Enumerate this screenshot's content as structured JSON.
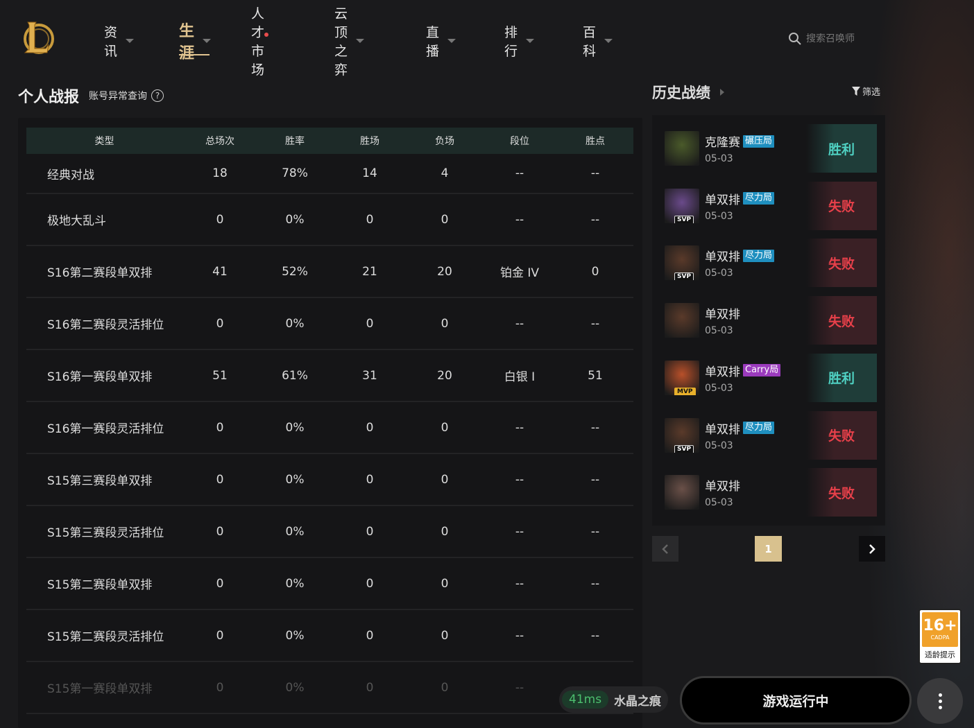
{
  "nav": {
    "items": [
      {
        "label": "资讯",
        "dropdown": true
      },
      {
        "label": "生涯",
        "dropdown": true,
        "active": true
      },
      {
        "label": "人才市场",
        "dropdown": false,
        "dot": true
      },
      {
        "label": "云顶之弈",
        "dropdown": true
      },
      {
        "label": "直播",
        "dropdown": true
      },
      {
        "label": "排行",
        "dropdown": true
      },
      {
        "label": "百科",
        "dropdown": true
      }
    ],
    "search_placeholder": "搜索召唤师"
  },
  "stats": {
    "title": "个人战报",
    "subtitle": "账号异常查询",
    "help_symbol": "?",
    "headers": [
      "类型",
      "总场次",
      "胜率",
      "胜场",
      "负场",
      "段位",
      "胜点"
    ],
    "rows": [
      [
        "经典对战",
        "18",
        "78%",
        "14",
        "4",
        "--",
        "--"
      ],
      [
        "极地大乱斗",
        "0",
        "0%",
        "0",
        "0",
        "--",
        "--"
      ],
      [
        "S16第二赛段单双排",
        "41",
        "52%",
        "21",
        "20",
        "铂金 IV",
        "0"
      ],
      [
        "S16第二赛段灵活排位",
        "0",
        "0%",
        "0",
        "0",
        "--",
        "--"
      ],
      [
        "S16第一赛段单双排",
        "51",
        "61%",
        "31",
        "20",
        "白银 I",
        "51"
      ],
      [
        "S16第一赛段灵活排位",
        "0",
        "0%",
        "0",
        "0",
        "--",
        "--"
      ],
      [
        "S15第三赛段单双排",
        "0",
        "0%",
        "0",
        "0",
        "--",
        "--"
      ],
      [
        "S15第三赛段灵活排位",
        "0",
        "0%",
        "0",
        "0",
        "--",
        "--"
      ],
      [
        "S15第二赛段单双排",
        "0",
        "0%",
        "0",
        "0",
        "--",
        "--"
      ],
      [
        "S15第二赛段灵活排位",
        "0",
        "0%",
        "0",
        "0",
        "--",
        "--"
      ],
      [
        "S15第一赛段单双排",
        "0",
        "0%",
        "0",
        "0",
        "--",
        "--"
      ]
    ]
  },
  "history": {
    "title": "历史战绩",
    "filter_label": "筛选",
    "matches": [
      {
        "mode": "克隆赛",
        "tag": "碾压局",
        "tag_color": "blue",
        "date": "05-03",
        "result": "胜利",
        "outcome": "win",
        "badge": "",
        "avatar_color": "#4a5a2a"
      },
      {
        "mode": "单双排",
        "tag": "尽力局",
        "tag_color": "blue",
        "date": "05-03",
        "result": "失败",
        "outcome": "lose",
        "badge": "SVP",
        "avatar_color": "#6a4a8a"
      },
      {
        "mode": "单双排",
        "tag": "尽力局",
        "tag_color": "blue",
        "date": "05-03",
        "result": "失败",
        "outcome": "lose",
        "badge": "SVP",
        "avatar_color": "#5a3a2a"
      },
      {
        "mode": "单双排",
        "tag": "",
        "tag_color": "",
        "date": "05-03",
        "result": "失败",
        "outcome": "lose",
        "badge": "",
        "avatar_color": "#5a3a2a"
      },
      {
        "mode": "单双排",
        "tag": "Carry局",
        "tag_color": "purple",
        "date": "05-03",
        "result": "胜利",
        "outcome": "win",
        "badge": "MVP",
        "avatar_color": "#b8502a"
      },
      {
        "mode": "单双排",
        "tag": "尽力局",
        "tag_color": "blue",
        "date": "05-03",
        "result": "失败",
        "outcome": "lose",
        "badge": "SVP",
        "avatar_color": "#5a3a2a"
      },
      {
        "mode": "单双排",
        "tag": "",
        "tag_color": "",
        "date": "05-03",
        "result": "失败",
        "outcome": "lose",
        "badge": "",
        "avatar_color": "#6a5048"
      }
    ],
    "page": "1"
  },
  "footer": {
    "ping": "41ms",
    "server": "水晶之痕",
    "game_button": "游戏运行中"
  },
  "age_rating": {
    "rating": "16+",
    "org": "CADPA",
    "tip": "适龄提示"
  },
  "colors": {
    "accent_gold": "#e2c591",
    "win": "#4fd0c2",
    "lose": "#e8404a"
  }
}
